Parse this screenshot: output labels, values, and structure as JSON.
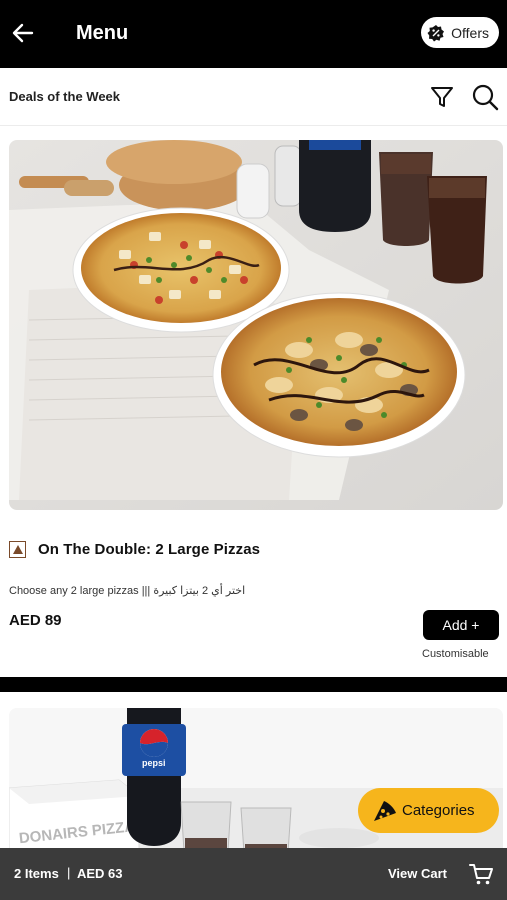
{
  "header": {
    "title": "Menu",
    "back_icon": "arrow-left-icon",
    "offers_label": "Offers",
    "offers_icon": "discount-badge-icon"
  },
  "subbar": {
    "section_title": "Deals of the Week",
    "filter_icon": "filter-icon",
    "search_icon": "search-icon"
  },
  "items": [
    {
      "title": "On The Double: 2 Large Pizzas",
      "description": "Choose any 2 large pizzas ||| اختر أي 2 بيتزا كبيرة",
      "price": "AED 89",
      "add_label": "Add +",
      "customisable_label": "Customisable",
      "veg_indicator_icon": "non-veg-indicator-icon",
      "image_icon": "pizza-photo"
    },
    {
      "image_icon": "pepsi-and-pizza-box-photo",
      "box_text": "DONAIRS PIZZA",
      "bottle_text": "pepsi"
    }
  ],
  "categories_button": {
    "label": "Categories",
    "icon": "pizza-slice-icon"
  },
  "cart_bar": {
    "item_count": "2 Items",
    "separator": "|",
    "total": "AED 63",
    "view_cart_label": "View Cart",
    "cart_icon": "cart-icon"
  },
  "colors": {
    "header_bg": "#000000",
    "accent_yellow": "#f6b51c",
    "cart_bar_bg": "#3b3b3b",
    "add_button_bg": "#000000"
  }
}
